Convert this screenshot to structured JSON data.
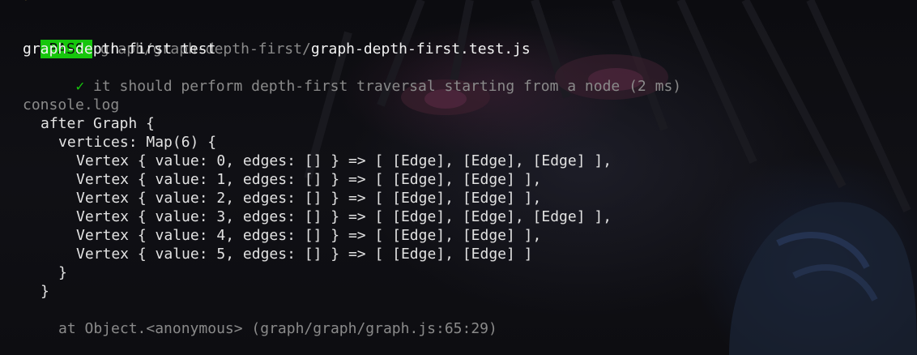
{
  "status": {
    "badge": "PASS",
    "path_prefix": "graph/graph-depth-first/",
    "file_name": "graph-depth-first.test.js"
  },
  "suite": {
    "name": "graph-depth-first test",
    "check_mark": "✓",
    "test_name": "it should perform depth-first traversal starting from a node (2 ms)"
  },
  "console": {
    "header": "console.log",
    "lines": [
      "after Graph {",
      "vertices: Map(6) {",
      "Vertex { value: 0, edges: [] } => [ [Edge], [Edge], [Edge] ],",
      "Vertex { value: 1, edges: [] } => [ [Edge], [Edge] ],",
      "Vertex { value: 2, edges: [] } => [ [Edge], [Edge] ],",
      "Vertex { value: 3, edges: [] } => [ [Edge], [Edge], [Edge] ],",
      "Vertex { value: 4, edges: [] } => [ [Edge], [Edge] ],",
      "Vertex { value: 5, edges: [] } => [ [Edge], [Edge] ]",
      "}",
      "}"
    ],
    "location": "at Object.<anonymous> (graph/graph/graph.js:65:29)"
  },
  "colors": {
    "pass_green": "#16c60c",
    "dim_text": "#8a8a8a",
    "bright_text": "#f2f2f2",
    "background": "#0b0b0e"
  }
}
